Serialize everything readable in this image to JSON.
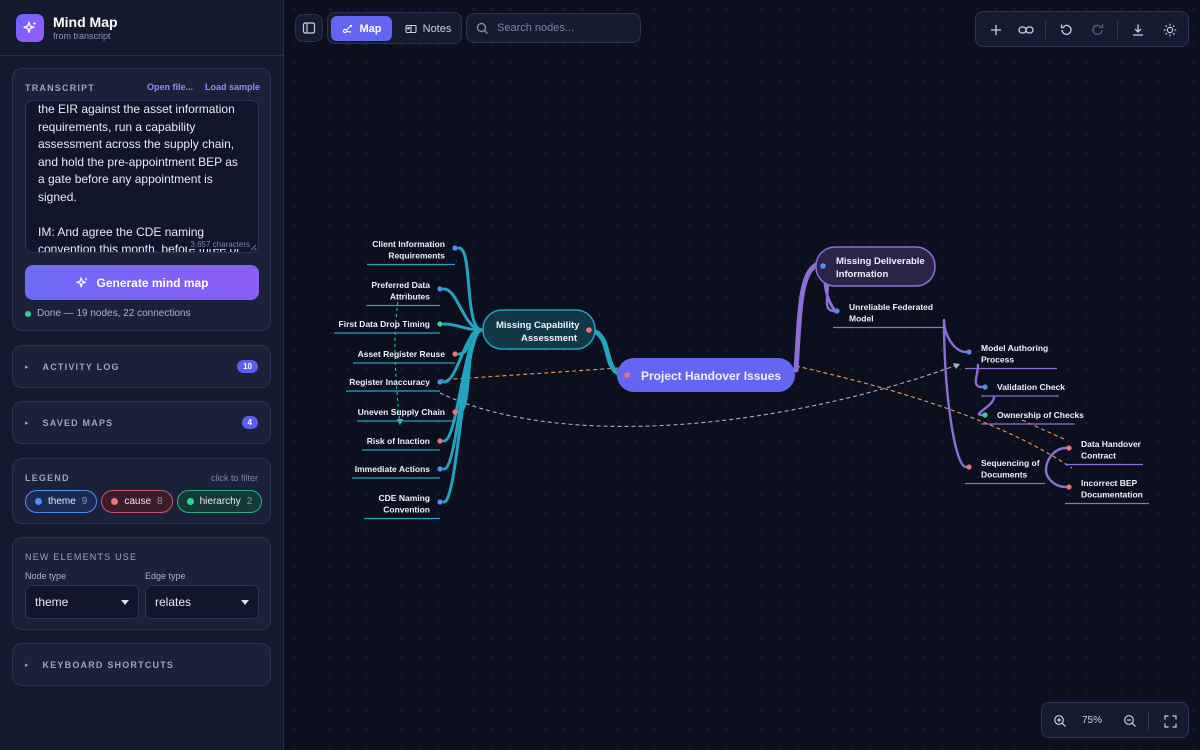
{
  "app": {
    "title": "Mind Map",
    "subtitle": "from transcript"
  },
  "transcript": {
    "label": "TRANSCRIPT",
    "open_file": "Open file...",
    "load_sample": "Load sample",
    "text": "the EIR against the asset information requirements, run a capability assessment across the supply chain, and hold the pre-appointment BEP as a gate before any appointment is signed.\n\nIM: And agree the CDE naming convention this month, before three of them exist.",
    "char_count": "3,657 characters",
    "generate_label": "Generate mind map",
    "status": "Done — 19 nodes, 22 connections"
  },
  "sections": {
    "activity_log": {
      "label": "ACTIVITY LOG",
      "count": "10"
    },
    "saved_maps": {
      "label": "SAVED MAPS",
      "count": "4"
    },
    "shortcuts": {
      "label": "KEYBOARD SHORTCUTS"
    }
  },
  "legend": {
    "label": "LEGEND",
    "hint": "click to filter",
    "items": [
      {
        "name": "theme",
        "count": "9",
        "color": "#4f8df7"
      },
      {
        "name": "cause",
        "count": "8",
        "color": "#f07178"
      },
      {
        "name": "hierarchy",
        "count": "2",
        "color": "#34d399"
      }
    ]
  },
  "new_elements": {
    "label": "NEW ELEMENTS USE",
    "node_type_label": "Node type",
    "node_type_value": "theme",
    "edge_type_label": "Edge type",
    "edge_type_value": "relates"
  },
  "toolbar": {
    "tab_map": "Map",
    "tab_notes": "Notes",
    "search_placeholder": "Search nodes...",
    "zoom": "75%"
  },
  "map": {
    "root": "Project Handover Issues",
    "left_branch": {
      "title_lines": [
        "Missing Capability",
        "Assessment"
      ],
      "children": [
        [
          "Client Information",
          "Requirements"
        ],
        [
          "Preferred Data",
          "Attributes"
        ],
        [
          "First Data Drop Timing"
        ],
        [
          "Asset Register Reuse"
        ],
        [
          "Register Inaccuracy"
        ],
        [
          "Uneven Supply Chain"
        ],
        [
          "Risk of Inaction"
        ],
        [
          "Immediate Actions"
        ],
        [
          "CDE Naming",
          "Convention"
        ]
      ]
    },
    "right_branch": {
      "title_lines": [
        "Missing Deliverable",
        "Information"
      ],
      "children": [
        [
          "Unreliable Federated",
          "Model"
        ],
        [
          "Model Authoring",
          "Process"
        ],
        [
          "Validation Check"
        ],
        [
          "Ownership of Checks"
        ],
        [
          "Sequencing of",
          "Documents"
        ],
        [
          "Data Handover",
          "Contract"
        ],
        [
          "Incorrect BEP",
          "Documentation"
        ]
      ]
    }
  },
  "colors": {
    "accent": "#6366f1",
    "left_branch": "#22a3bf",
    "right_branch": "#8b6fd6",
    "cause_edge": "#f29a4a",
    "relates_edge": "#a8b0c8"
  }
}
